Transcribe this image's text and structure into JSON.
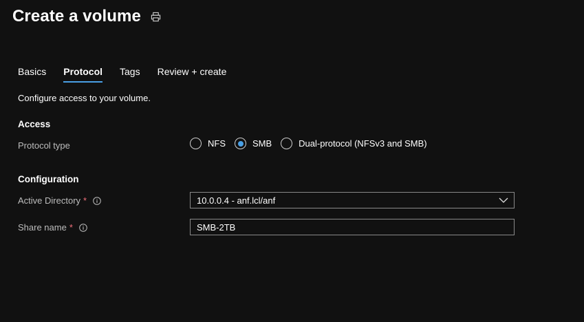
{
  "header": {
    "title": "Create a volume",
    "print_icon": "print-icon"
  },
  "tabs": [
    {
      "label": "Basics",
      "active": false
    },
    {
      "label": "Protocol",
      "active": true
    },
    {
      "label": "Tags",
      "active": false
    },
    {
      "label": "Review + create",
      "active": false
    }
  ],
  "intro_text": "Configure access to your volume.",
  "access": {
    "section_title": "Access",
    "protocol_label": "Protocol type",
    "options": [
      {
        "label": "NFS",
        "checked": false
      },
      {
        "label": "SMB",
        "checked": true
      },
      {
        "label": "Dual-protocol (NFSv3 and SMB)",
        "checked": false
      }
    ]
  },
  "configuration": {
    "section_title": "Configuration",
    "active_directory": {
      "label": "Active Directory",
      "required_mark": "*",
      "value": "10.0.0.4 - anf.lcl/anf"
    },
    "share_name": {
      "label": "Share name",
      "required_mark": "*",
      "value": "SMB-2TB"
    }
  },
  "colors": {
    "background": "#111111",
    "accent": "#4aa0e6",
    "required": "#f1707b",
    "label": "#bdbdbd"
  }
}
